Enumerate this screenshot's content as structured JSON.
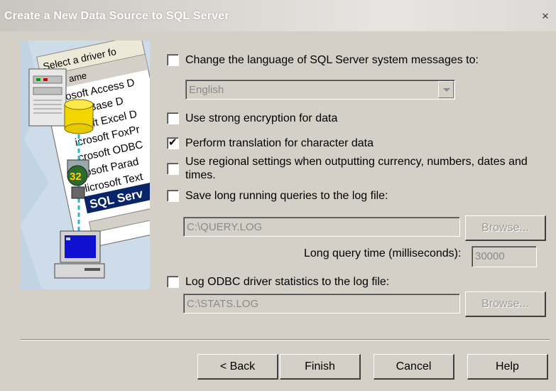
{
  "window": {
    "title": "Create a New Data Source to SQL Server",
    "close_glyph": "×"
  },
  "art": {
    "header_text": "Select a driver fo",
    "column_label": "ame",
    "drivers": [
      "osoft Access D",
      "oft dBase D",
      "rosoft Excel D",
      "icrosoft FoxPr",
      "crosoft ODBC",
      "rosoft Parad",
      "licrosoft Text",
      "SQL Serv"
    ],
    "badge": "32"
  },
  "options": {
    "language": {
      "label": "Change the language of SQL Server system messages to:",
      "checked": false,
      "value": "English"
    },
    "encryption": {
      "label": "Use strong encryption for data",
      "checked": false
    },
    "translation": {
      "label": "Perform translation for character data",
      "checked": true
    },
    "regional": {
      "label_line1": "Use regional settings when outputting currency, numbers, dates and",
      "label_line2": "times.",
      "checked": false
    },
    "long_queries": {
      "label": "Save long running queries to the log file:",
      "checked": false,
      "path": "C:\\QUERY.LOG",
      "browse_label": "Browse...",
      "time_label": "Long query time (milliseconds):",
      "time_value": "30000"
    },
    "odbc_stats": {
      "label": "Log ODBC driver statistics to the log file:",
      "checked": false,
      "path": "C:\\STATS.LOG",
      "browse_label": "Browse..."
    }
  },
  "buttons": {
    "back": "< Back",
    "finish": "Finish",
    "cancel": "Cancel",
    "help": "Help"
  }
}
